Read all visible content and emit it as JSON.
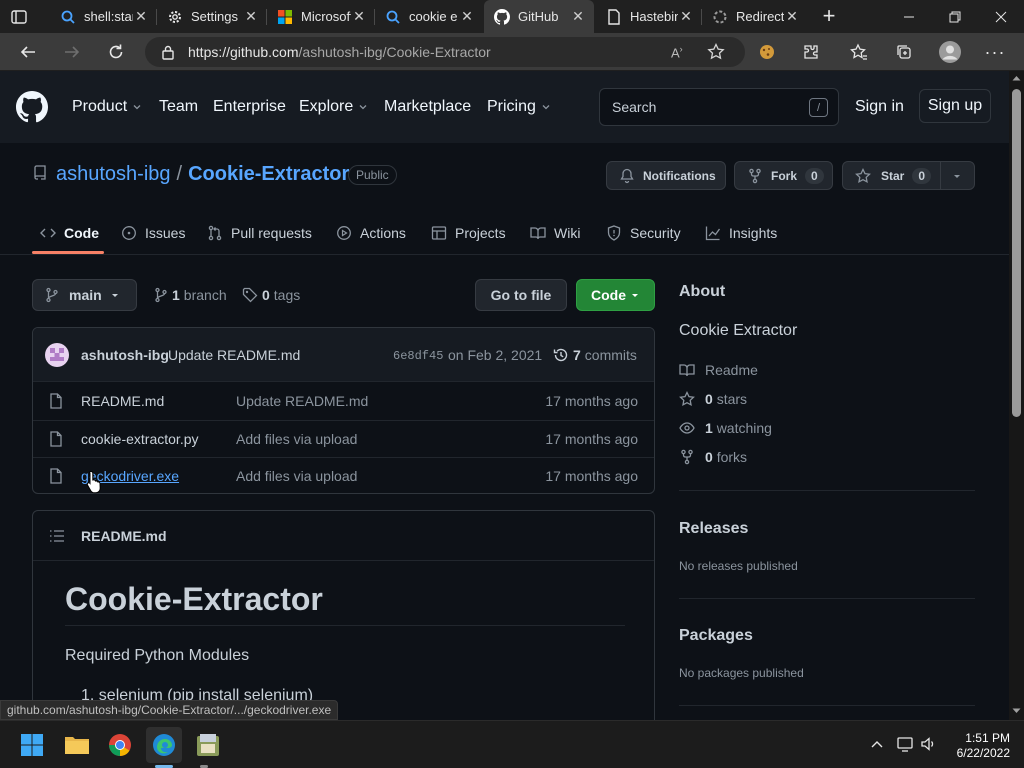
{
  "browser": {
    "tabs": [
      {
        "title": "shell:start",
        "icon": "search-icon",
        "active": false
      },
      {
        "title": "Settings",
        "icon": "gear-icon",
        "active": false
      },
      {
        "title": "Microsoft",
        "icon": "microsoft-logo-icon",
        "active": false
      },
      {
        "title": "cookie e",
        "icon": "search-icon",
        "active": false
      },
      {
        "title": "GitHub",
        "icon": "github-icon",
        "active": true
      },
      {
        "title": "Hastebin",
        "icon": "page-icon",
        "active": false
      },
      {
        "title": "Redirect",
        "icon": "spinner-icon",
        "active": false
      }
    ],
    "url_host": "https://github.com",
    "url_path": "/ashutosh-ibg/Cookie-Extractor",
    "status_url": "github.com/ashutosh-ibg/Cookie-Extractor/.../geckodriver.exe"
  },
  "header": {
    "nav": [
      "Product",
      "Team",
      "Enterprise",
      "Explore",
      "Marketplace",
      "Pricing"
    ],
    "search_placeholder": "Search",
    "search_key": "/",
    "sign_in": "Sign in",
    "sign_up": "Sign up"
  },
  "repo": {
    "owner": "ashutosh-ibg",
    "slash": "/",
    "name": "Cookie-Extractor",
    "visibility": "Public",
    "notifications_label": "Notifications",
    "fork_label": "Fork",
    "fork_count": "0",
    "star_label": "Star",
    "star_count": "0",
    "tabs": [
      "Code",
      "Issues",
      "Pull requests",
      "Actions",
      "Projects",
      "Wiki",
      "Security",
      "Insights"
    ]
  },
  "code": {
    "branch": "main",
    "branch_count": "1",
    "branch_label": "branch",
    "tag_count": "0",
    "tag_label": "tags",
    "go_to_file": "Go to file",
    "code_button": "Code",
    "commit": {
      "author": "ashutosh-ibg",
      "message": "Update README.md",
      "sha": "6e8df45",
      "date": "on Feb 2, 2021",
      "count": "7",
      "count_label": "commits"
    },
    "files": [
      {
        "name": "README.md",
        "message": "Update README.md",
        "age": "17 months ago"
      },
      {
        "name": "cookie-extractor.py",
        "message": "Add files via upload",
        "age": "17 months ago"
      },
      {
        "name": "geckodriver.exe",
        "message": "Add files via upload",
        "age": "17 months ago"
      }
    ]
  },
  "readme": {
    "filename": "README.md",
    "title": "Cookie-Extractor",
    "subtitle": "Required Python Modules",
    "list_item": "1. selenium (pip install selenium)"
  },
  "about": {
    "heading": "About",
    "description": "Cookie Extractor",
    "readme": "Readme",
    "stars_count": "0",
    "stars_label": "stars",
    "watching_count": "1",
    "watching_label": "watching",
    "forks_count": "0",
    "forks_label": "forks",
    "releases_heading": "Releases",
    "releases_text": "No releases published",
    "packages_heading": "Packages",
    "packages_text": "No packages published"
  },
  "taskbar": {
    "time": "1:51 PM",
    "date": "6/22/2022"
  },
  "colors": {
    "accent_link": "#58a6ff",
    "code_button": "#238636",
    "tab_underline": "#f78166"
  }
}
